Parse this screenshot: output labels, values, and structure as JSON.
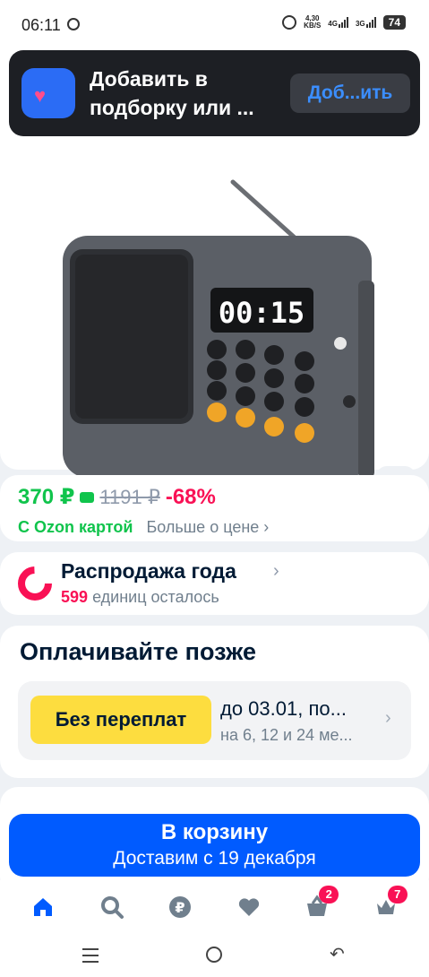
{
  "status_bar": {
    "time": "06:11",
    "speed_value": "4,30",
    "speed_unit": "KB/S",
    "net1": "4G",
    "net2": "3G",
    "battery": "74"
  },
  "toast": {
    "text": "Добавить в подборку или ...",
    "button_label": "Доб...ить"
  },
  "price": {
    "current": "370 ₽",
    "old": "1191 ₽",
    "discount": "-68%",
    "ozon_card_label": "С Ozon картой",
    "more_label": "Больше о цене"
  },
  "sale": {
    "title": "Распродажа года",
    "count": "599",
    "remaining_label": "единиц осталось"
  },
  "pay_later": {
    "title": "Оплачивайте позже",
    "badge": "Без переплат",
    "line1": "до 03.01, по...",
    "line2": "на 6, 12 и 24 ме..."
  },
  "cart_button": {
    "label": "В корзину",
    "delivery": "Доставим с 19 декабря"
  },
  "bottom_nav": {
    "cart_badge": "2",
    "profile_badge": "7"
  },
  "product_display": {
    "screen_time": "00:15"
  },
  "colors": {
    "accent_blue": "#005bff",
    "price_green": "#10c44c",
    "discount_pink": "#f91155",
    "badge_yellow": "#fddd3f"
  }
}
